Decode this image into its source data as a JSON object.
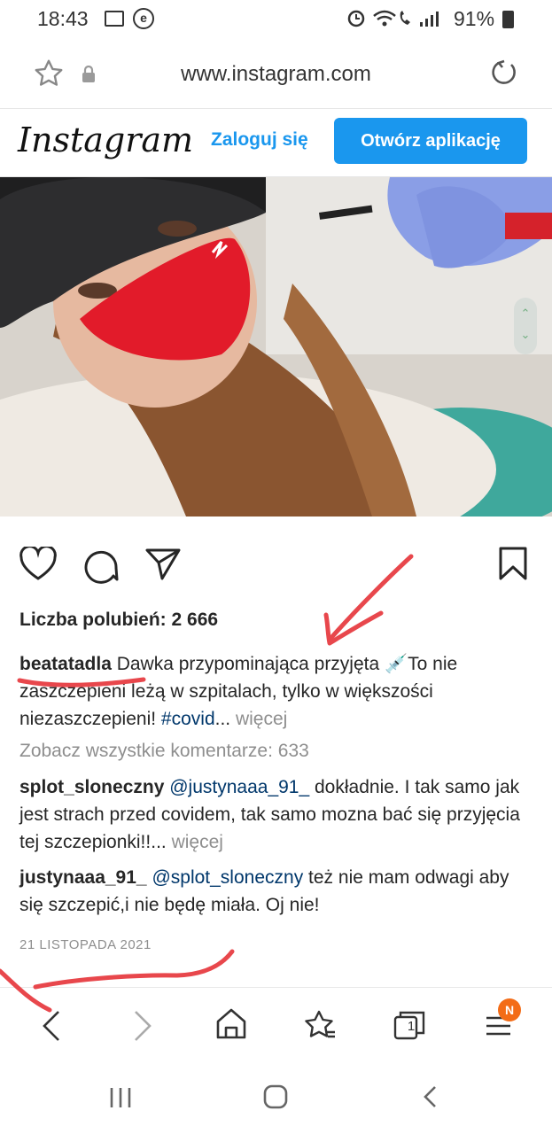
{
  "status_bar": {
    "time": "18:43",
    "e_icon_letter": "e",
    "battery": "91%"
  },
  "browser": {
    "url": "www.instagram.com"
  },
  "instagram_header": {
    "logo_text": "Instagram",
    "login_label": "Zaloguj się",
    "open_app_label": "Otwórz aplikację"
  },
  "post": {
    "likes": "Liczba polubień: 2 666",
    "author": "beatatadla",
    "caption_text": " Dawka przypominająca przyjęta 💉To nie zaszczepieni leżą w szpitalach, tylko w większości niezaszczepieni! ",
    "caption_hashtag": "#covid",
    "caption_ellipsis": "... ",
    "more_label": "więcej",
    "view_all_comments": "Zobacz wszystkie komentarze: 633",
    "comments": [
      {
        "user": "splot_sloneczny",
        "mention": "@justynaaa_91_",
        "text": " dokładnie. I tak samo jak jest strach przed covidem, tak samo mozna bać się przyjęcia tej szczepionki!!... ",
        "more": "więcej"
      },
      {
        "user": "justynaaa_91_",
        "mention": "@splot_sloneczny",
        "text": " też nie mam odwagi aby się szczepić,i nie będę miała. Oj nie!"
      }
    ],
    "date": "21 LISTOPADA 2021"
  },
  "toolbar": {
    "tab_count": "1",
    "menu_badge": "N"
  },
  "colors": {
    "accent": "#1a97ee",
    "badge": "#f36c17",
    "annotation": "#e8474c"
  }
}
